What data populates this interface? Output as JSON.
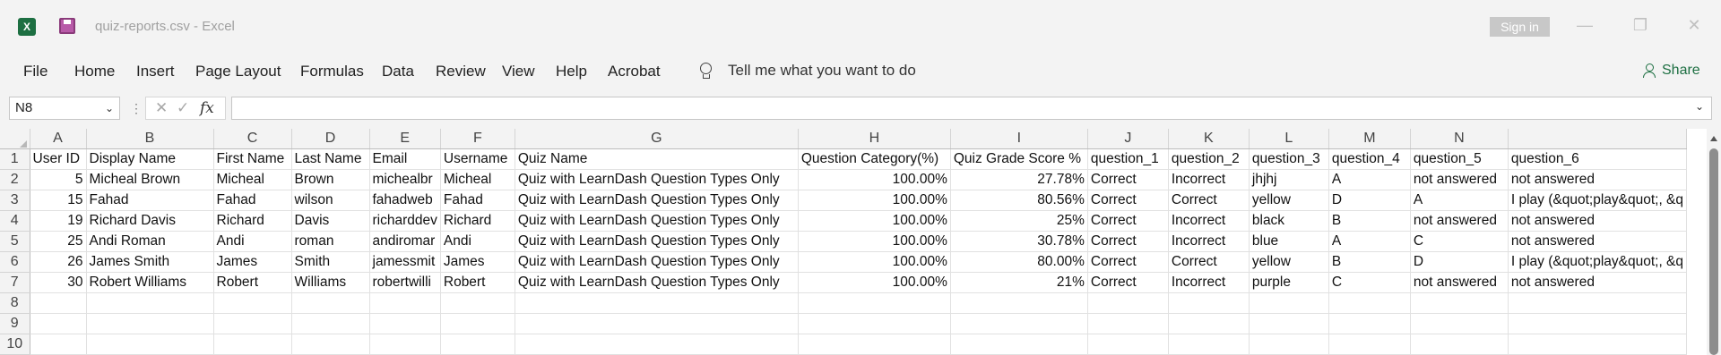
{
  "window": {
    "title": "quiz-reports.csv  -  Excel",
    "signin_label": "Sign in",
    "app_icon_letter": "X"
  },
  "ribbon": {
    "tabs": [
      "File",
      "Home",
      "Insert",
      "Page Layout",
      "Formulas",
      "Data",
      "Review",
      "View",
      "Help",
      "Acrobat"
    ],
    "tell_me": "Tell me what you want to do",
    "share_label": "Share"
  },
  "formula_bar": {
    "name_box": "N8",
    "fx_label": "fx",
    "formula": ""
  },
  "sheet": {
    "columns": [
      "A",
      "B",
      "C",
      "D",
      "E",
      "F",
      "G",
      "H",
      "I",
      "J",
      "K",
      "L",
      "M",
      "N",
      ""
    ],
    "row_numbers": [
      "1",
      "2",
      "3",
      "4",
      "5",
      "6",
      "7",
      "8",
      "9",
      "10"
    ],
    "rows": [
      [
        "User ID",
        "Display Name",
        "First Name",
        "Last Name",
        "Email",
        "Username",
        "Quiz Name",
        "Question Category(%)",
        "Quiz Grade Score %",
        "question_1",
        "question_2",
        "question_3",
        "question_4",
        "question_5",
        "question_6"
      ],
      [
        "5",
        "Micheal Brown",
        "Micheal",
        "Brown",
        "michealbr",
        "Micheal",
        "Quiz with LearnDash Question Types Only",
        "100.00%",
        "27.78%",
        "Correct",
        "Incorrect",
        "jhjhj",
        "A",
        "not answered",
        "not answered"
      ],
      [
        "15",
        "Fahad",
        "Fahad",
        "wilson",
        "fahadweb",
        "Fahad",
        "Quiz with LearnDash Question Types Only",
        "100.00%",
        "80.56%",
        "Correct",
        "Correct",
        "yellow",
        "D",
        "A",
        "I play (&quot;play&quot;, &q"
      ],
      [
        "19",
        "Richard Davis",
        "Richard",
        "Davis",
        "richarddev",
        "Richard",
        "Quiz with LearnDash Question Types Only",
        "100.00%",
        "25%",
        "Correct",
        "Incorrect",
        "black",
        "B",
        "not answered",
        "not answered"
      ],
      [
        "25",
        "Andi Roman",
        "Andi",
        "roman",
        "andiromar",
        "Andi",
        "Quiz with LearnDash Question Types Only",
        "100.00%",
        "30.78%",
        "Correct",
        "Incorrect",
        "blue",
        "A",
        "C",
        "not answered"
      ],
      [
        "26",
        "James Smith",
        "James",
        "Smith",
        "jamessmit",
        "James",
        "Quiz with LearnDash Question Types Only",
        "100.00%",
        "80.00%",
        "Correct",
        "Correct",
        "yellow",
        "B",
        "D",
        "I play (&quot;play&quot;, &q"
      ],
      [
        "30",
        "Robert Williams",
        "Robert",
        "Williams",
        "robertwilli",
        "Robert",
        "Quiz with LearnDash Question Types Only",
        "100.00%",
        "21%",
        "Correct",
        "Incorrect",
        "purple",
        "C",
        "not answered",
        "not answered"
      ],
      [
        "",
        "",
        "",
        "",
        "",
        "",
        "",
        "",
        "",
        "",
        "",
        "",
        "",
        "",
        ""
      ],
      [
        "",
        "",
        "",
        "",
        "",
        "",
        "",
        "",
        "",
        "",
        "",
        "",
        "",
        "",
        ""
      ],
      [
        "",
        "",
        "",
        "",
        "",
        "",
        "",
        "",
        "",
        "",
        "",
        "",
        "",
        "",
        ""
      ]
    ],
    "numeric_columns": [
      0,
      7,
      8
    ]
  }
}
